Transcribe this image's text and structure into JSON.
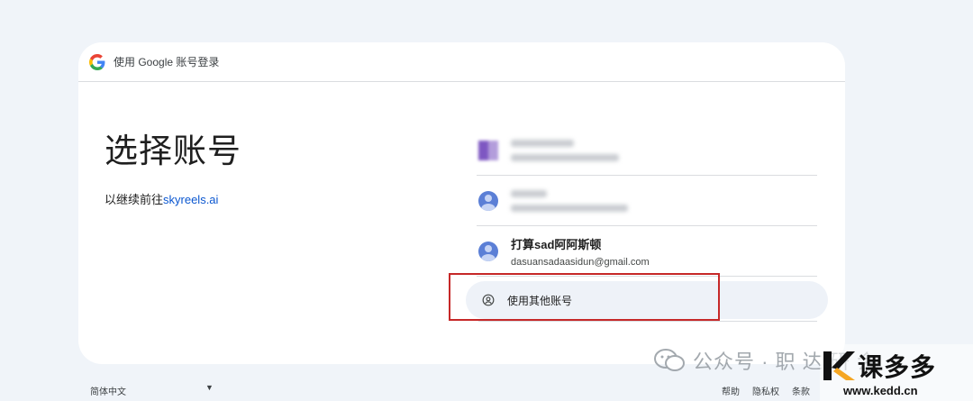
{
  "header": {
    "text": "使用 Google 账号登录"
  },
  "main": {
    "title": "选择账号",
    "subtitle_prefix": "以继续前往",
    "subtitle_link": "skyreels.ai"
  },
  "accounts": [
    {
      "name": "",
      "email": "",
      "avatar": "purple-avatar",
      "blurred": true
    },
    {
      "name": "",
      "email": "",
      "avatar": "person-avatar",
      "blurred": true
    },
    {
      "name": "打算sad阿阿斯顿",
      "email": "dasuansadaasidun@gmail.com",
      "avatar": "person-avatar",
      "blurred": false
    }
  ],
  "other_account": {
    "label": "使用其他账号",
    "icon": "account-circle-icon"
  },
  "footer": {
    "language": "简体中文",
    "links": [
      "帮助",
      "隐私权",
      "条款"
    ]
  },
  "watermark": {
    "text": "公众号 · 职 达 研 会"
  },
  "brand": {
    "name": "课多多",
    "url": "www.kedd.cn"
  },
  "colors": {
    "page_bg": "#f0f4f9",
    "card_bg": "#ffffff",
    "link": "#0b57d0",
    "highlight": "#c62828"
  }
}
